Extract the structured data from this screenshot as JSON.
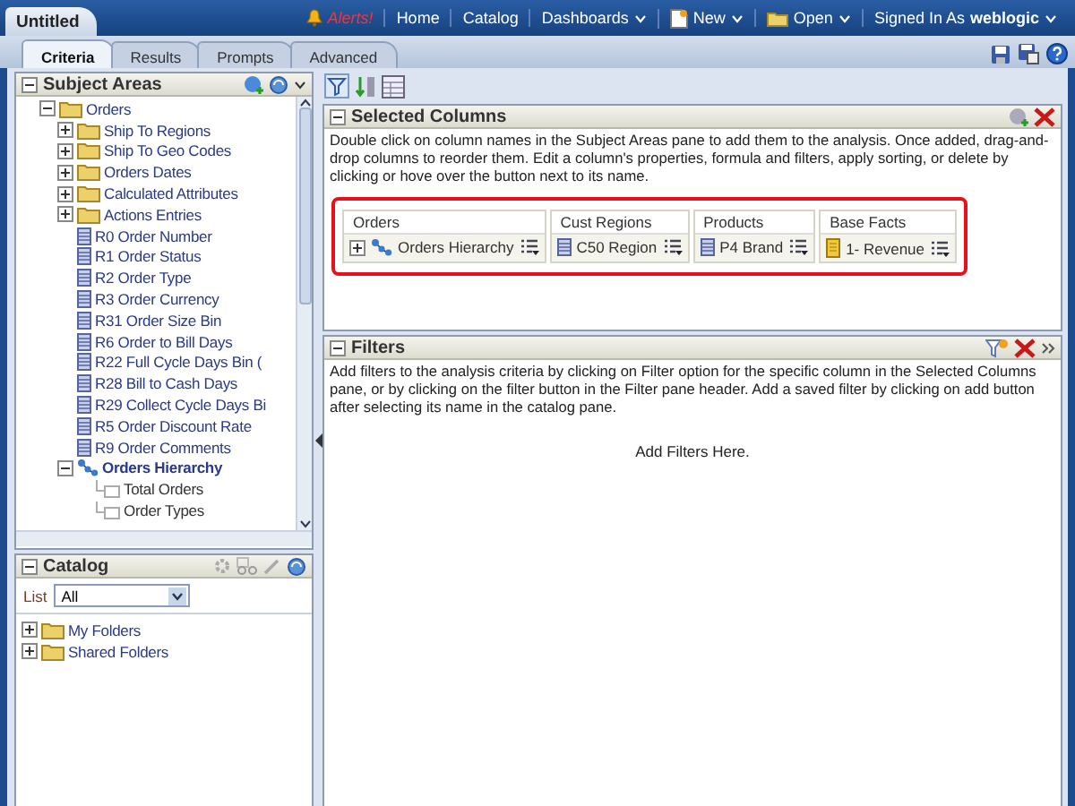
{
  "app_tab": {
    "title": "Untitled"
  },
  "header_nav": [
    {
      "label": "Alerts!",
      "kind": "alert"
    },
    {
      "label": "Home",
      "kind": "link"
    },
    {
      "label": "Catalog",
      "kind": "link"
    },
    {
      "label": "Dashboards",
      "kind": "menu"
    },
    {
      "label": "New",
      "kind": "new"
    },
    {
      "label": "Open",
      "kind": "open"
    }
  ],
  "signed_in": {
    "label": "Signed In As",
    "user": "weblogic"
  },
  "tabs": [
    {
      "label": "Criteria",
      "selected": true
    },
    {
      "label": "Results",
      "selected": false
    },
    {
      "label": "Prompts",
      "selected": false
    },
    {
      "label": "Advanced",
      "selected": false
    }
  ],
  "subject_areas": {
    "title": "Subject Areas",
    "expanded": true,
    "tree": [
      {
        "label": "Orders",
        "kind": "folder",
        "expanded": true,
        "children": [
          {
            "label": "Ship To Regions",
            "kind": "folder",
            "expanded": false
          },
          {
            "label": "Ship To Geo Codes",
            "kind": "folder",
            "expanded": false
          },
          {
            "label": "Orders Dates",
            "kind": "folder",
            "expanded": false
          },
          {
            "label": "Calculated Attributes",
            "kind": "folder",
            "expanded": false
          },
          {
            "label": "Actions Entries",
            "kind": "folder",
            "expanded": false
          },
          {
            "label": "R0  Order Number",
            "kind": "column"
          },
          {
            "label": "R1  Order Status",
            "kind": "column"
          },
          {
            "label": "R2  Order Type",
            "kind": "column"
          },
          {
            "label": "R3  Order Currency",
            "kind": "column"
          },
          {
            "label": "R31  Order Size Bin",
            "kind": "column"
          },
          {
            "label": "R6  Order to Bill Days",
            "kind": "column"
          },
          {
            "label": "R22  Full Cycle Days Bin (",
            "kind": "column"
          },
          {
            "label": "R28  Bill to Cash Days",
            "kind": "column"
          },
          {
            "label": "R29  Collect Cycle Days Bi",
            "kind": "column"
          },
          {
            "label": "R5  Order Discount Rate",
            "kind": "column"
          },
          {
            "label": "R9  Order Comments",
            "kind": "column"
          },
          {
            "label": "Orders Hierarchy",
            "kind": "hierarchy",
            "expanded": true,
            "children": [
              {
                "label": "Total Orders",
                "kind": "level"
              },
              {
                "label": "Order Types",
                "kind": "level"
              }
            ]
          }
        ]
      }
    ]
  },
  "catalog": {
    "title": "Catalog",
    "expanded": true,
    "list_label": "List",
    "list_value": "All",
    "tree": [
      {
        "label": "My Folders",
        "kind": "folder",
        "expanded": false
      },
      {
        "label": "Shared Folders",
        "kind": "folder",
        "expanded": false
      }
    ]
  },
  "selected_columns": {
    "title": "Selected Columns",
    "expanded": true,
    "description": "Double click on column names in the Subject Areas pane to add them to the analysis. Once added, drag-and-drop columns to reorder them. Edit a column's properties, formula and filters, apply sorting, or delete by clicking or hove over the button next to its name.",
    "columns": [
      {
        "heading": "Orders",
        "kind": "hierarchy",
        "label": "Orders Hierarchy"
      },
      {
        "heading": "Cust Regions",
        "kind": "column",
        "label": "C50  Region"
      },
      {
        "heading": "Products",
        "kind": "column",
        "label": "P4  Brand"
      },
      {
        "heading": "Base Facts",
        "kind": "measure",
        "label": "1- Revenue"
      }
    ]
  },
  "filters": {
    "title": "Filters",
    "expanded": true,
    "description": "Add filters to the analysis criteria by clicking on Filter option for the specific column in the Selected Columns pane, or by clicking on the filter button in the Filter pane header. Add a saved filter by clicking on add button after selecting its name in the catalog pane.",
    "empty_text": "Add Filters Here."
  }
}
